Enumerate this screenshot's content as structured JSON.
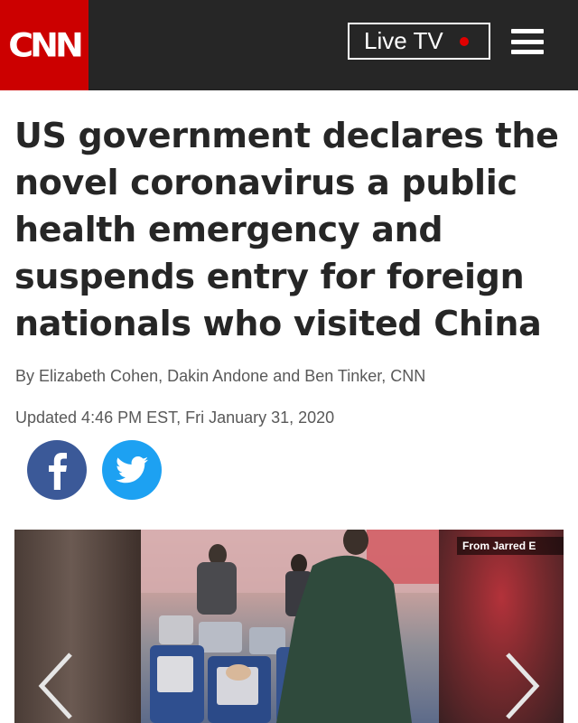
{
  "header": {
    "logo_text": "CNN",
    "live_tv_label": "Live TV",
    "colors": {
      "brand_red": "#cc0000",
      "bar": "#262626",
      "live_dot": "#e00000"
    }
  },
  "article": {
    "headline": "US government declares the novel coronavirus a public health emergency and suspends entry for foreign nationals who visited China",
    "byline": "By Elizabeth Cohen, Dakin Andone and Ben Tinker, CNN",
    "updated": "Updated 4:46 PM EST, Fri January 31, 2020"
  },
  "share": {
    "facebook_icon": "facebook-icon",
    "twitter_icon": "twitter-icon",
    "colors": {
      "facebook": "#3b5998",
      "twitter": "#1da1f2"
    }
  },
  "gallery": {
    "credit": "From Jarred E",
    "prev_icon": "chevron-left-icon",
    "next_icon": "chevron-right-icon"
  }
}
